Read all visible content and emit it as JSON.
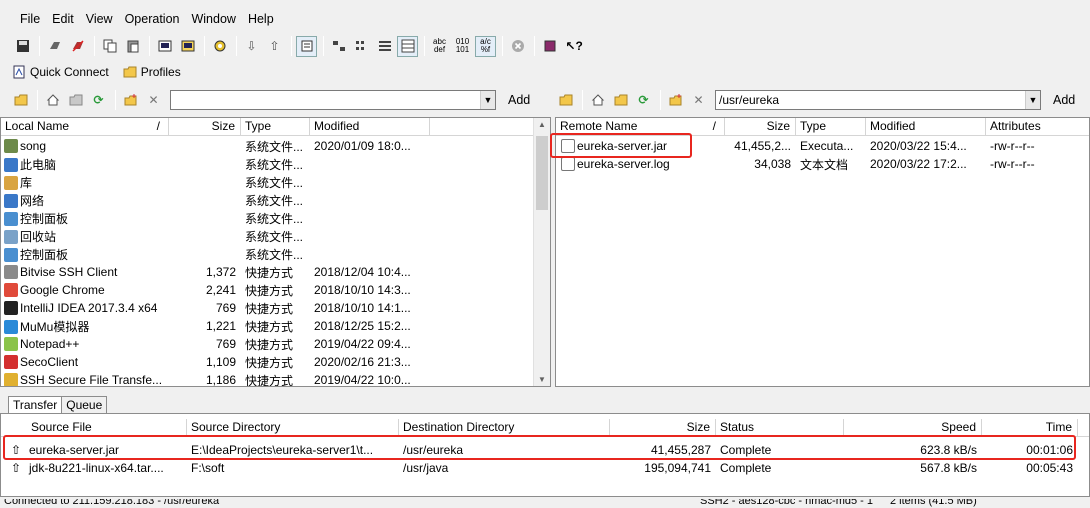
{
  "menu": [
    "File",
    "Edit",
    "View",
    "Operation",
    "Window",
    "Help"
  ],
  "quick": {
    "connect": "Quick Connect",
    "profiles": "Profiles"
  },
  "local_path": "",
  "remote_path": "/usr/eureka",
  "add_label": "Add",
  "local": {
    "columns": [
      "Local Name",
      "/",
      "Size",
      "Type",
      "Modified"
    ],
    "rows": [
      {
        "name": "song",
        "size": "",
        "type": "系统文件...",
        "modified": "2020/01/09 18:0...",
        "icon": "user-icon",
        "color": "#6d8a4a"
      },
      {
        "name": "此电脑",
        "size": "",
        "type": "系统文件...",
        "modified": "",
        "icon": "computer-icon",
        "color": "#3a78c8"
      },
      {
        "name": "库",
        "size": "",
        "type": "系统文件...",
        "modified": "",
        "icon": "library-icon",
        "color": "#d9a441"
      },
      {
        "name": "网络",
        "size": "",
        "type": "系统文件...",
        "modified": "",
        "icon": "network-icon",
        "color": "#3a78c8"
      },
      {
        "name": "控制面板",
        "size": "",
        "type": "系统文件...",
        "modified": "",
        "icon": "control-panel-icon",
        "color": "#4a8fd0"
      },
      {
        "name": "回收站",
        "size": "",
        "type": "系统文件...",
        "modified": "",
        "icon": "recycle-bin-icon",
        "color": "#7aa2c8"
      },
      {
        "name": "控制面板",
        "size": "",
        "type": "系统文件...",
        "modified": "",
        "icon": "control-panel-icon",
        "color": "#4a8fd0"
      },
      {
        "name": "Bitvise SSH Client",
        "size": "1,372",
        "type": "快捷方式",
        "modified": "2018/12/04 10:4...",
        "icon": "bitvise-icon",
        "color": "#8a8a8a"
      },
      {
        "name": "Google Chrome",
        "size": "2,241",
        "type": "快捷方式",
        "modified": "2018/10/10 14:3...",
        "icon": "chrome-icon",
        "color": "#e04a3a"
      },
      {
        "name": "IntelliJ IDEA 2017.3.4 x64",
        "size": "769",
        "type": "快捷方式",
        "modified": "2018/10/10 14:1...",
        "icon": "intellij-icon",
        "color": "#222222"
      },
      {
        "name": "MuMu模拟器",
        "size": "1,221",
        "type": "快捷方式",
        "modified": "2018/12/25 15:2...",
        "icon": "mumu-icon",
        "color": "#2a8ad8"
      },
      {
        "name": "Notepad++",
        "size": "769",
        "type": "快捷方式",
        "modified": "2019/04/22 09:4...",
        "icon": "notepad-icon",
        "color": "#8bc34a"
      },
      {
        "name": "SecoClient",
        "size": "1,109",
        "type": "快捷方式",
        "modified": "2020/02/16 21:3...",
        "icon": "secoclient-icon",
        "color": "#d32f2f"
      },
      {
        "name": "SSH Secure File Transfe...",
        "size": "1,186",
        "type": "快捷方式",
        "modified": "2019/04/22 10:0...",
        "icon": "ssh-icon",
        "color": "#e0b030"
      }
    ]
  },
  "remote": {
    "columns": [
      "Remote Name",
      "/",
      "Size",
      "Type",
      "Modified",
      "Attributes"
    ],
    "rows": [
      {
        "name": "eureka-server.jar",
        "size": "41,455,2...",
        "type": "Executa...",
        "modified": "2020/03/22 15:4...",
        "attributes": "-rw-r--r--",
        "icon": "jar-icon"
      },
      {
        "name": "eureka-server.log",
        "size": "34,038",
        "type": "文本文档",
        "modified": "2020/03/22 17:2...",
        "attributes": "-rw-r--r--",
        "icon": "text-file-icon"
      }
    ]
  },
  "tabs": [
    "Transfer",
    "Queue"
  ],
  "transfer": {
    "columns": [
      "Source File",
      "Source Directory",
      "Destination Directory",
      "Size",
      "Status",
      "Speed",
      "Time"
    ],
    "rows": [
      {
        "file": "eureka-server.jar",
        "src": "E:\\IdeaProjects\\eureka-server1\\t...",
        "dst": "/usr/eureka",
        "size": "41,455,287",
        "status": "Complete",
        "speed": "623.8 kB/s",
        "time": "00:01:06"
      },
      {
        "file": "jdk-8u221-linux-x64.tar....",
        "src": "F:\\soft",
        "dst": "/usr/java",
        "size": "195,094,741",
        "status": "Complete",
        "speed": "567.8 kB/s",
        "time": "00:05:43"
      }
    ]
  },
  "status": {
    "left": "Connected to 211.159.218.183 - /usr/eureka",
    "mid": "SSH2 - aes128-cbc - hmac-md5 - 1",
    "right": "2 items (41.5 MB)"
  }
}
